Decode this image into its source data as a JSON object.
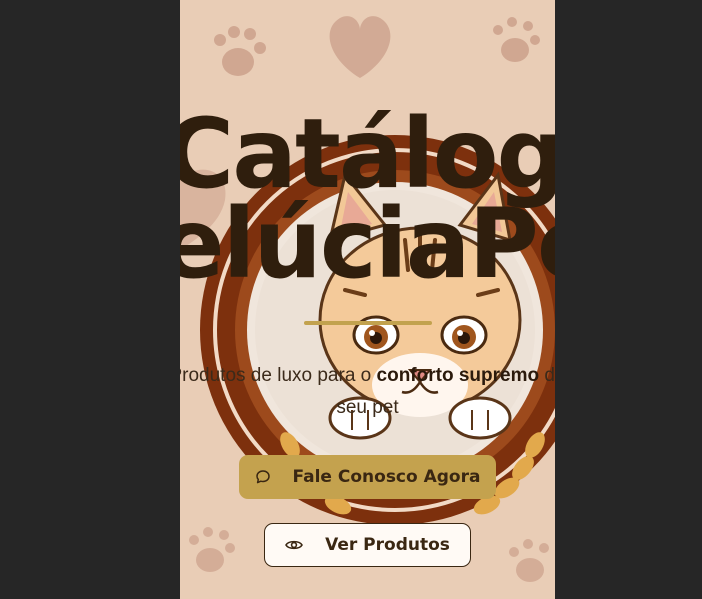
{
  "hero": {
    "title_line1": "Catálogo",
    "title_line2": "PelúciaPet",
    "tagline_pre": "Produtos de luxo para o ",
    "tagline_bold": "conforto supremo",
    "tagline_post": " do seu pet"
  },
  "buttons": {
    "contact_label": "Fale Conosco Agora",
    "contact_icon": "chat-bubble-icon",
    "products_label": "Ver Produtos",
    "products_icon": "eye-icon"
  },
  "colors": {
    "page_bg": "#262626",
    "panel_bg": "#e9cdb6",
    "title": "#2f1e0d",
    "accent_gold": "#c4a24e",
    "badge_brown": "#8b3c10"
  }
}
